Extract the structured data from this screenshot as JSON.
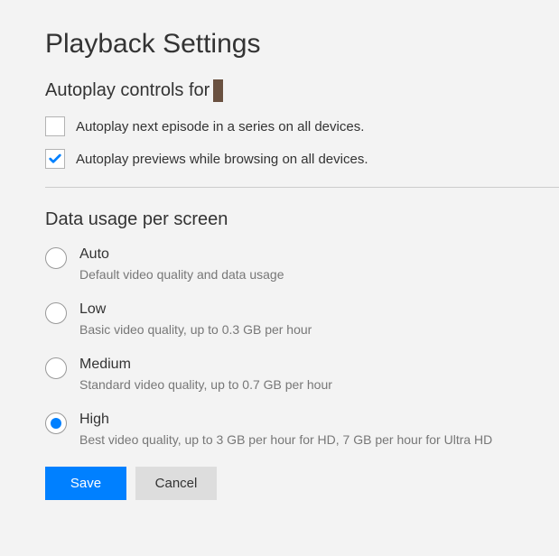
{
  "title": "Playback Settings",
  "autoplay_section": {
    "heading_prefix": "Autoplay controls for",
    "options": [
      {
        "label": "Autoplay next episode in a series on all devices.",
        "checked": false
      },
      {
        "label": "Autoplay previews while browsing on all devices.",
        "checked": true
      }
    ]
  },
  "data_usage": {
    "heading": "Data usage per screen",
    "options": [
      {
        "label": "Auto",
        "desc": "Default video quality and data usage",
        "selected": false
      },
      {
        "label": "Low",
        "desc": "Basic video quality, up to 0.3 GB per hour",
        "selected": false
      },
      {
        "label": "Medium",
        "desc": "Standard video quality, up to 0.7 GB per hour",
        "selected": false
      },
      {
        "label": "High",
        "desc": "Best video quality, up to 3 GB per hour for HD, 7 GB per hour for Ultra HD",
        "selected": true
      }
    ]
  },
  "buttons": {
    "save": "Save",
    "cancel": "Cancel"
  }
}
